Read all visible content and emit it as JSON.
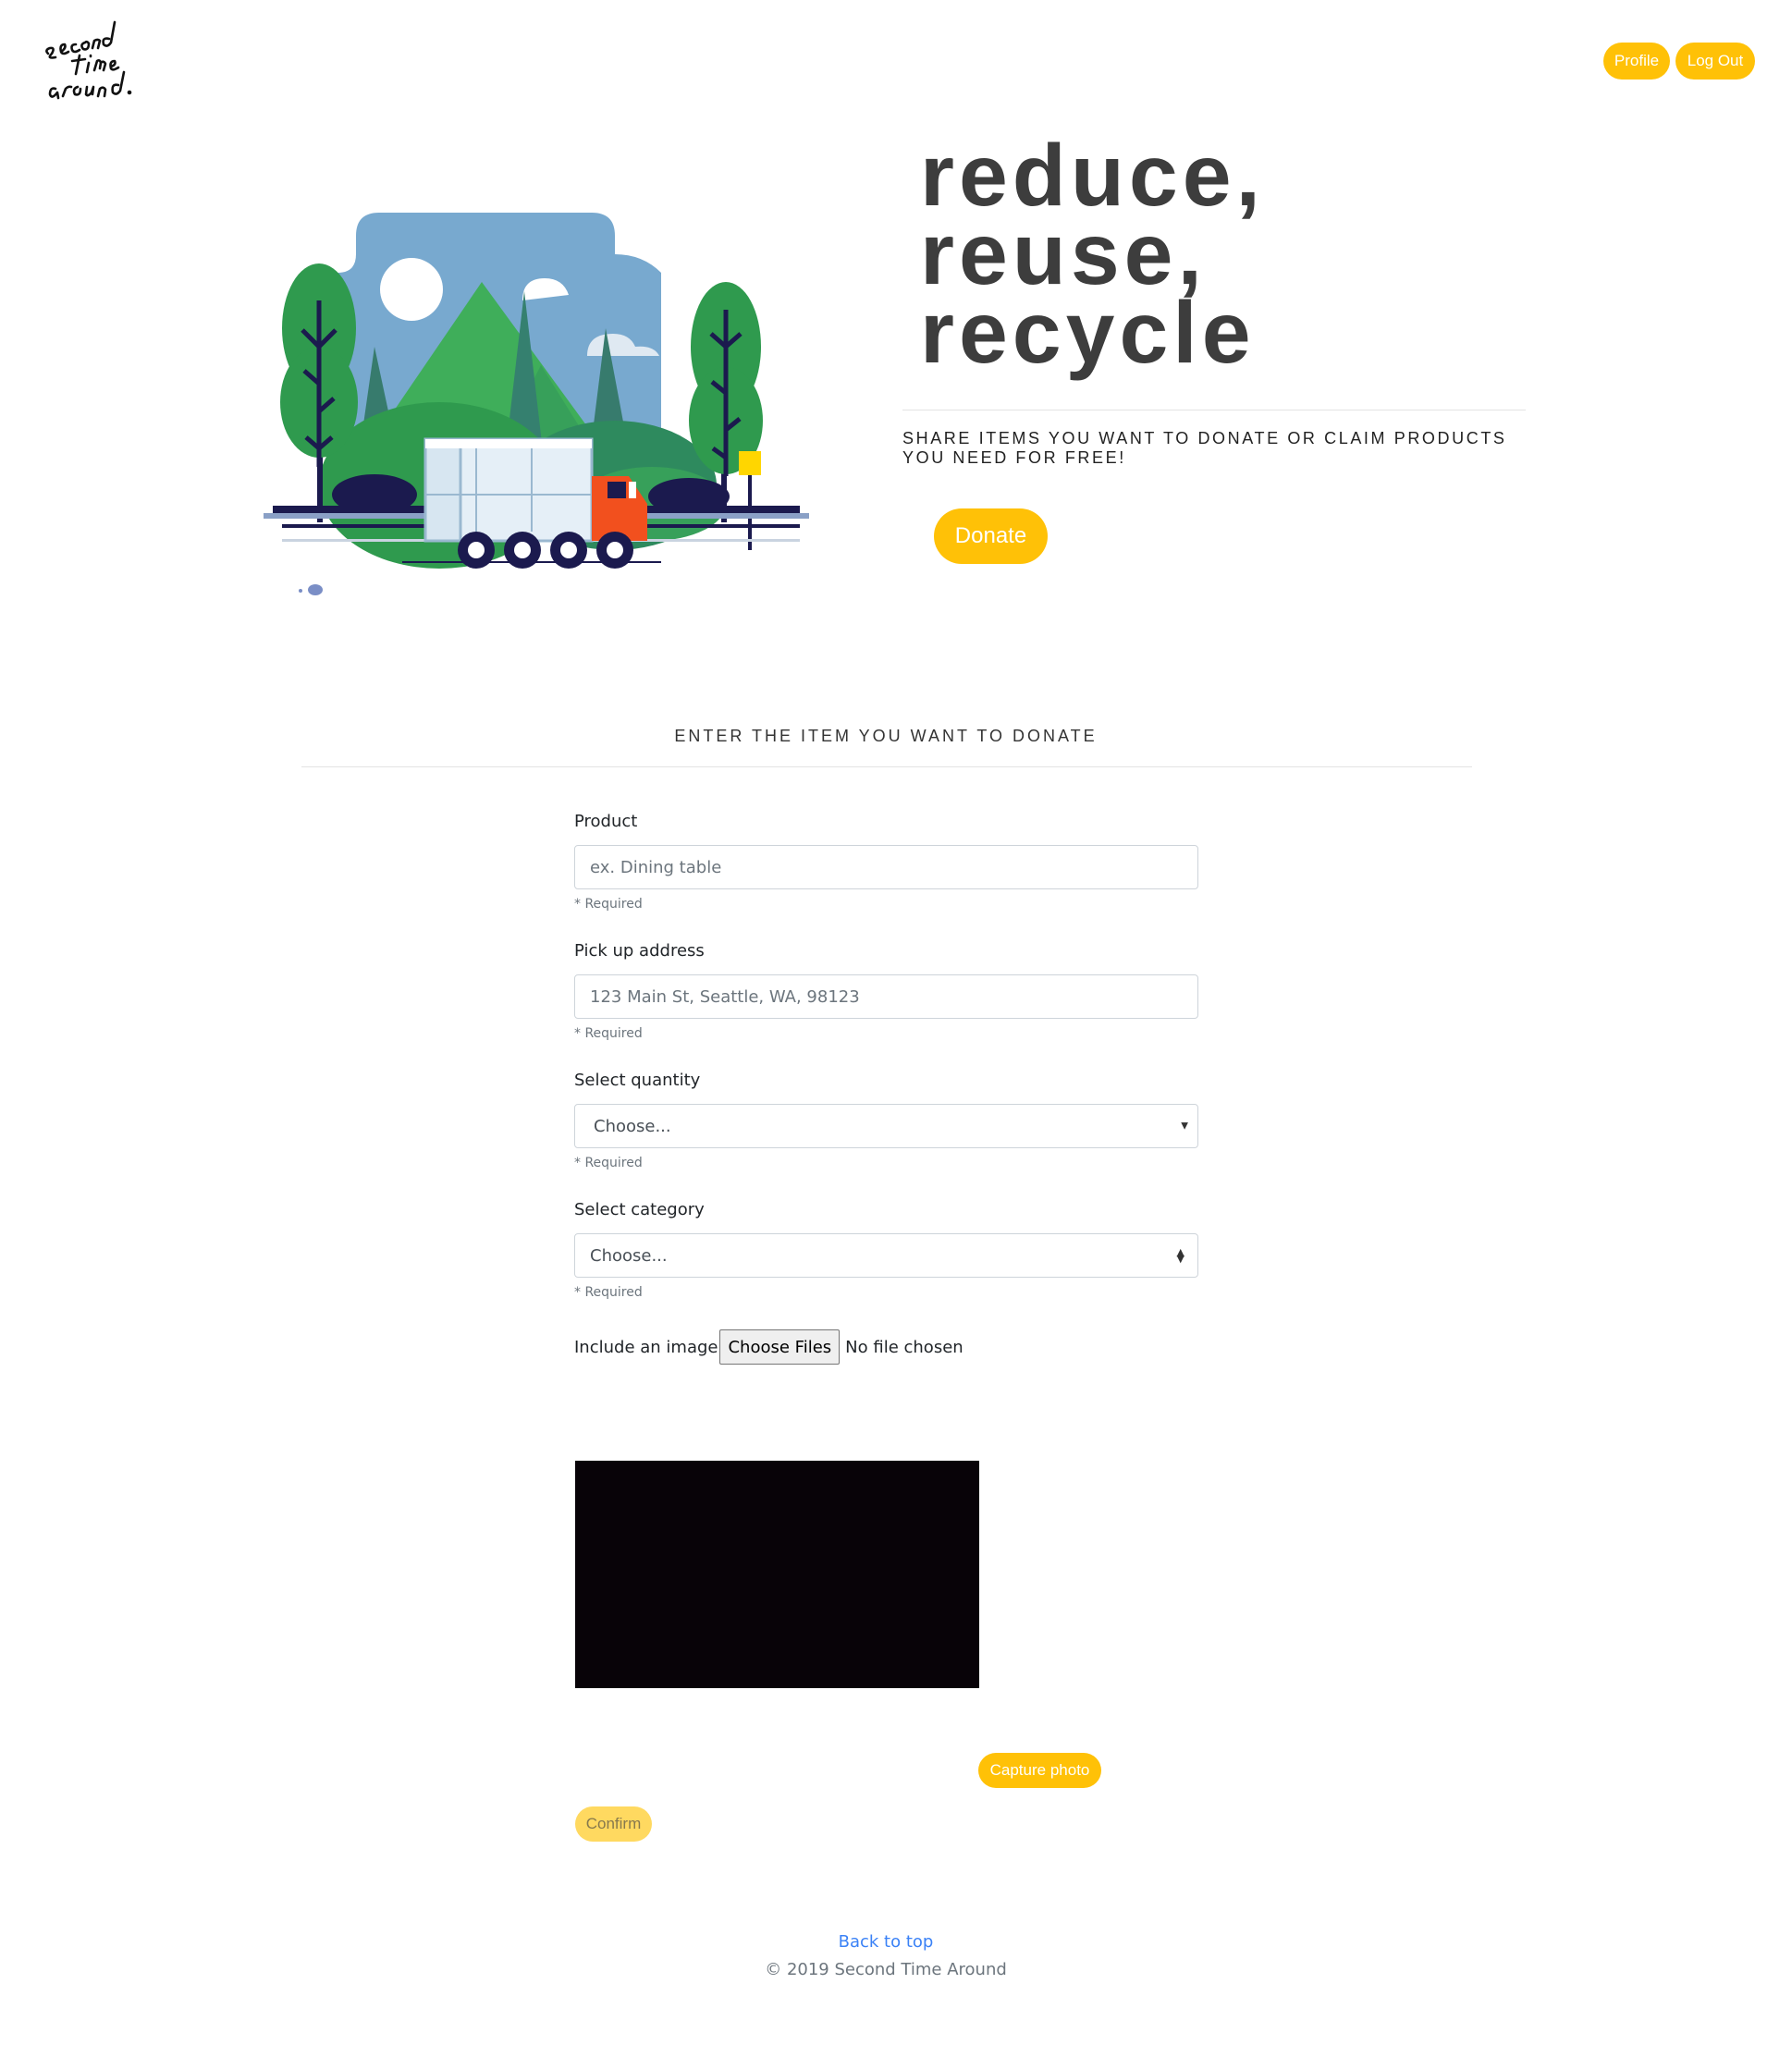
{
  "header": {
    "logo_text": "second time around",
    "profile_label": "Profile",
    "logout_label": "Log Out"
  },
  "hero": {
    "title_lines": [
      "reduce,",
      "reuse,",
      "recycle"
    ],
    "subtitle": "SHARE ITEMS YOU WANT TO DONATE OR CLAIM PRODUCTS YOU NEED FOR FREE!",
    "donate_label": "Donate"
  },
  "form": {
    "section_title": "ENTER THE ITEM YOU WANT TO DONATE",
    "product": {
      "label": "Product",
      "placeholder": "ex. Dining table",
      "help": "* Required"
    },
    "address": {
      "label": "Pick up address",
      "placeholder": "123 Main St, Seattle, WA, 98123",
      "help": "* Required"
    },
    "quantity": {
      "label": "Select quantity",
      "value": "Choose...",
      "help": "* Required"
    },
    "category": {
      "label": "Select category",
      "value": "Choose...",
      "help": "* Required"
    },
    "image": {
      "label": "Include an image",
      "button": "Choose Files",
      "status": "No file chosen"
    },
    "capture_label": "Capture photo",
    "confirm_label": "Confirm"
  },
  "footer": {
    "back_to_top": "Back to top",
    "copyright": "© 2019 Second Time Around"
  },
  "colors": {
    "accent": "#FFC107",
    "link": "#3b82f6",
    "video_bg": "#080308"
  }
}
